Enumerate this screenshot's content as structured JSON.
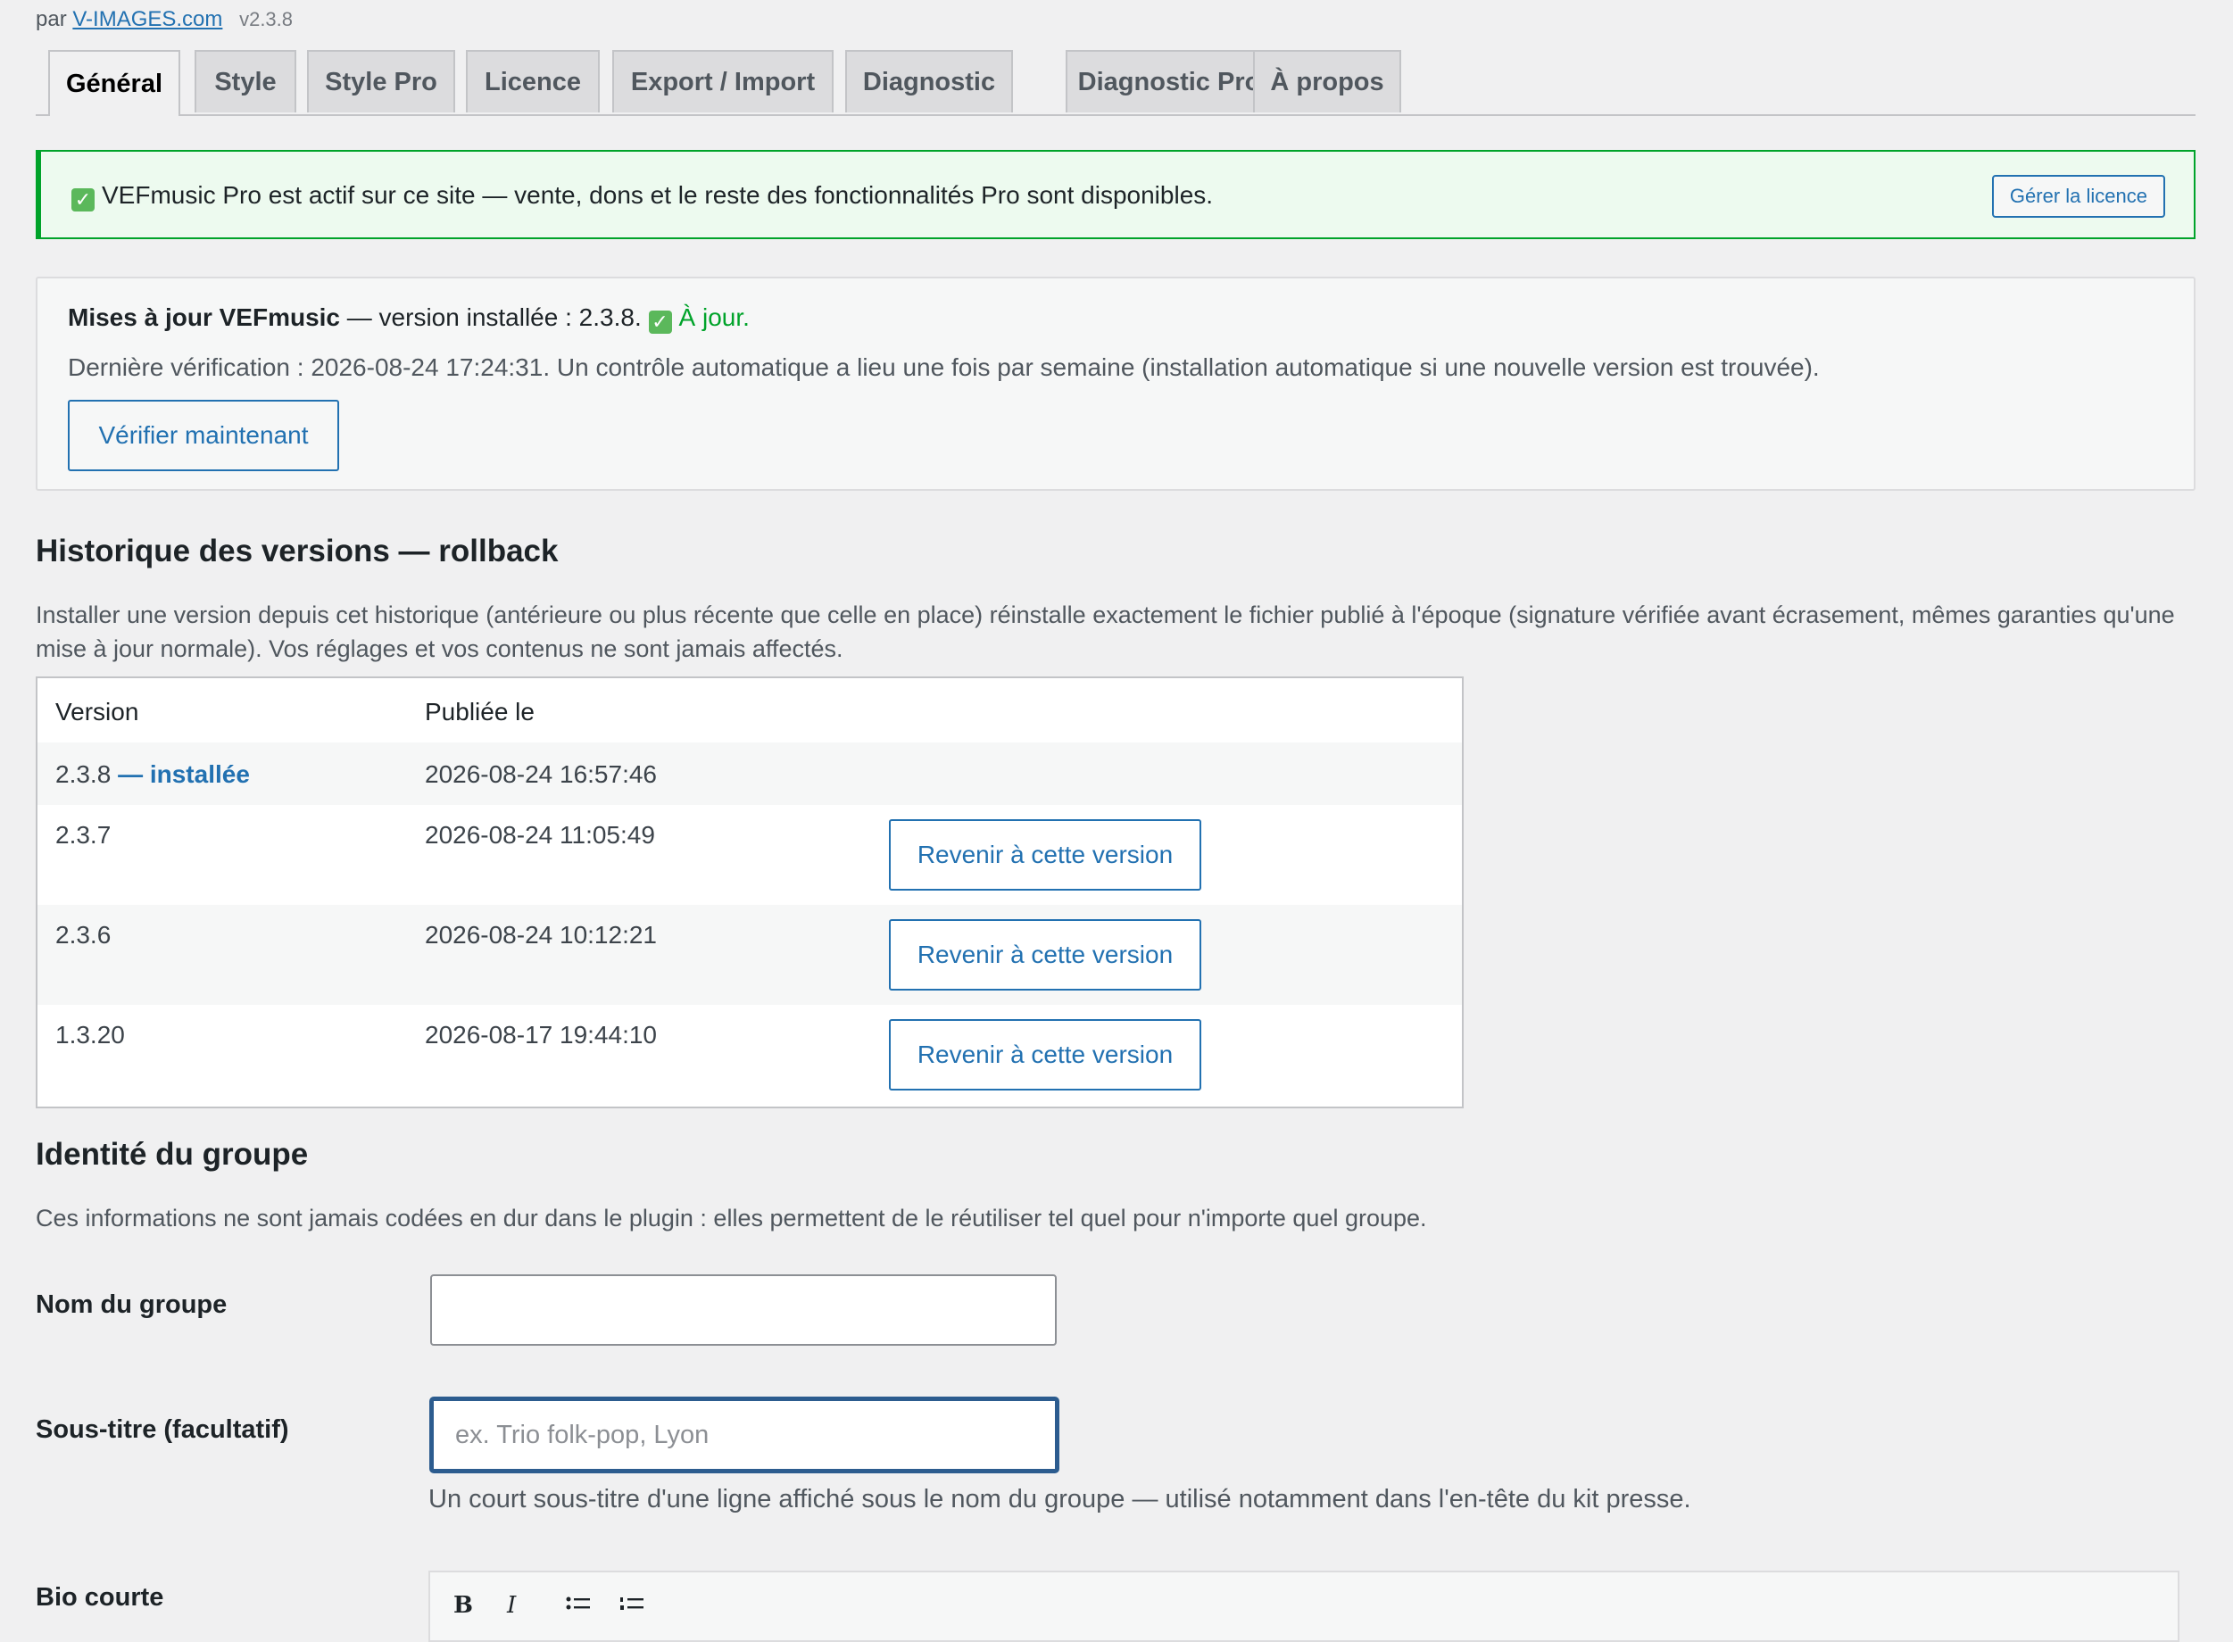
{
  "header": {
    "by_prefix": "par",
    "by_link": "V-IMAGES.com",
    "version": "v2.3.8"
  },
  "tabs": [
    {
      "label": "Général",
      "active": true
    },
    {
      "label": "Style"
    },
    {
      "label": "Style Pro"
    },
    {
      "label": "Licence"
    },
    {
      "label": "Export / Import"
    },
    {
      "label": "Diagnostic"
    },
    {
      "label": "Diagnostic Pro"
    },
    {
      "label": "À propos"
    }
  ],
  "license_notice": {
    "icon": "check-mark-icon",
    "text": "VEFmusic Pro est actif sur ce site — vente, dons et le reste des fonctionnalités Pro sont disponibles.",
    "button": "Gérer la licence",
    "color": "#00a32a"
  },
  "updates": {
    "title": "Mises à jour VEFmusic",
    "installed_text": " — version installée : 2.3.8.",
    "status": "À jour.",
    "last_check": "Dernière vérification : 2026-08-24 17:24:31. Un contrôle automatique a lieu une fois par semaine (installation automatique si une nouvelle version est trouvée).",
    "button": "Vérifier maintenant"
  },
  "history": {
    "heading": "Historique des versions — rollback",
    "description": "Installer une version depuis cet historique (antérieure ou plus récente que celle en place) réinstalle exactement le fichier publié à l'époque (signature vérifiée avant écrasement, mêmes garanties qu'une mise à jour normale). Vos réglages et vos contenus ne sont jamais affectés.",
    "columns": [
      "Version",
      "Publiée le"
    ],
    "rows": [
      {
        "version": "2.3.8",
        "installed_label": "— installée",
        "date": "2026-08-24 16:57:46",
        "action": ""
      },
      {
        "version": "2.3.7",
        "installed_label": "",
        "date": "2026-08-24 11:05:49",
        "action": "Revenir à cette version"
      },
      {
        "version": "2.3.6",
        "installed_label": "",
        "date": "2026-08-24 10:12:21",
        "action": "Revenir à cette version"
      },
      {
        "version": "1.3.20",
        "installed_label": "",
        "date": "2026-08-17 19:44:10",
        "action": "Revenir à cette version"
      }
    ]
  },
  "identity": {
    "heading": "Identité du groupe",
    "description": "Ces informations ne sont jamais codées en dur dans le plugin : elles permettent de le réutiliser tel quel pour n'importe quel groupe.",
    "name_label": "Nom du groupe",
    "name_value": "",
    "subtitle_label": "Sous-titre (facultatif)",
    "subtitle_placeholder": "ex. Trio folk-pop, Lyon",
    "subtitle_help": "Un court sous-titre d'une ligne affiché sous le nom du groupe — utilisé notamment dans l'en-tête du kit presse.",
    "bio_label": "Bio courte",
    "editor_tools": [
      "B",
      "I",
      "bulleted-list-icon",
      "numbered-list-icon"
    ]
  }
}
